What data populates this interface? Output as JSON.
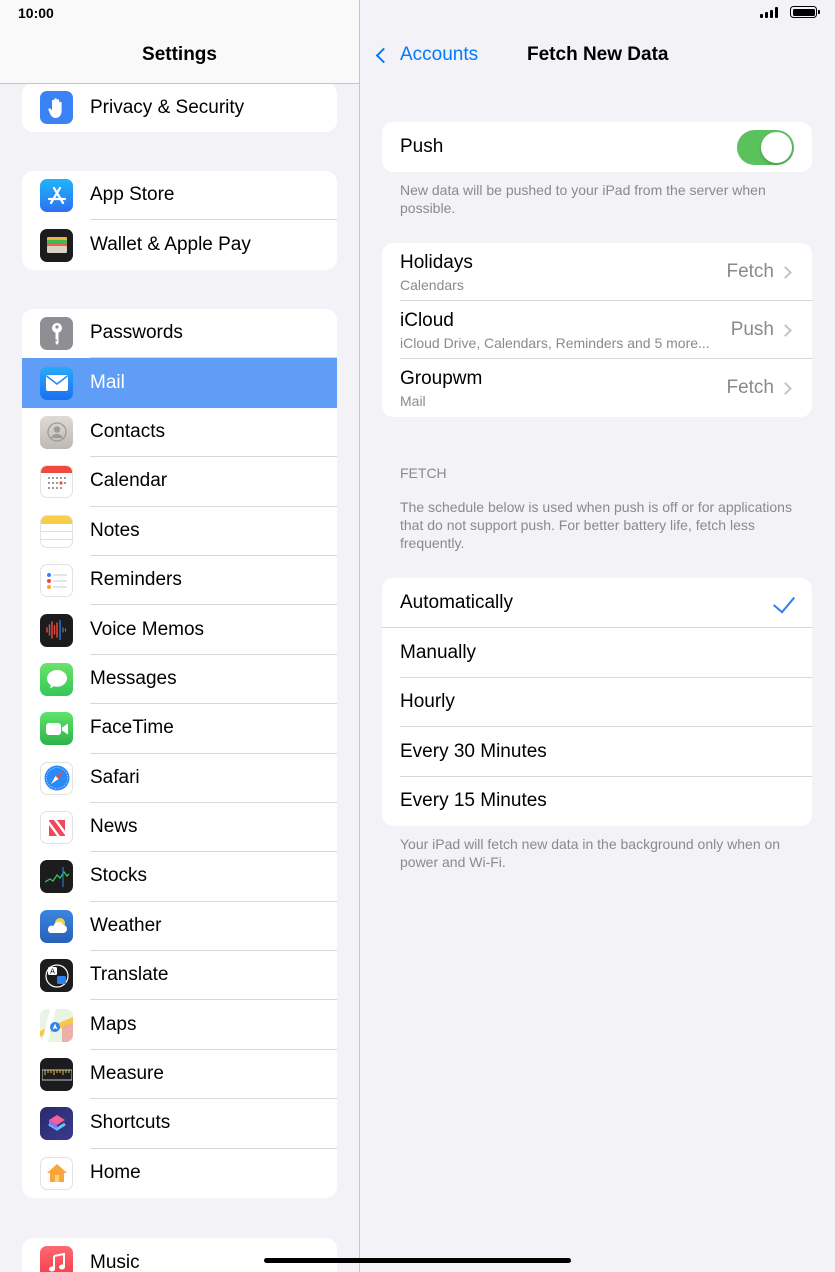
{
  "status": {
    "time": "10:00"
  },
  "left": {
    "title": "Settings",
    "groups": [
      [
        {
          "label": "Privacy & Security",
          "icon": "hand-icon",
          "color": "#3b82f6"
        }
      ],
      [
        {
          "label": "App Store",
          "icon": "app-store-icon",
          "color": "#2d8cf0"
        },
        {
          "label": "Wallet & Apple Pay",
          "icon": "wallet-icon",
          "color": "#1c1c1e"
        }
      ],
      [
        {
          "label": "Passwords",
          "icon": "key-icon",
          "color": "#8e8e93"
        },
        {
          "label": "Mail",
          "icon": "mail-icon",
          "color": "#3b95f5"
        },
        {
          "label": "Contacts",
          "icon": "contacts-icon",
          "color": "#c8c5bf"
        },
        {
          "label": "Calendar",
          "icon": "calendar-icon",
          "color": "#ffffff"
        },
        {
          "label": "Notes",
          "icon": "notes-icon",
          "color": "#ffffff"
        },
        {
          "label": "Reminders",
          "icon": "reminders-icon",
          "color": "#ffffff"
        },
        {
          "label": "Voice Memos",
          "icon": "voice-memos-icon",
          "color": "#1c1c1e"
        },
        {
          "label": "Messages",
          "icon": "messages-icon",
          "color": "#4cd964"
        },
        {
          "label": "FaceTime",
          "icon": "facetime-icon",
          "color": "#34c759"
        },
        {
          "label": "Safari",
          "icon": "safari-icon",
          "color": "#ffffff"
        },
        {
          "label": "News",
          "icon": "news-icon",
          "color": "#ffffff"
        },
        {
          "label": "Stocks",
          "icon": "stocks-icon",
          "color": "#1c1c1e"
        },
        {
          "label": "Weather",
          "icon": "weather-icon",
          "color": "#3a7bd5"
        },
        {
          "label": "Translate",
          "icon": "translate-icon",
          "color": "#1c1c1e"
        },
        {
          "label": "Maps",
          "icon": "maps-icon",
          "color": "#e8f4e4"
        },
        {
          "label": "Measure",
          "icon": "measure-icon",
          "color": "#1c1c1e"
        },
        {
          "label": "Shortcuts",
          "icon": "shortcuts-icon",
          "color": "#3a3a8c"
        },
        {
          "label": "Home",
          "icon": "home-icon",
          "color": "#ffffff"
        }
      ],
      [
        {
          "label": "Music",
          "icon": "music-icon",
          "color": "#fc3c44"
        }
      ]
    ],
    "selected": "Mail"
  },
  "right": {
    "back_label": "Accounts",
    "title": "Fetch New Data",
    "push": {
      "label": "Push",
      "on": true,
      "footer": "New data will be pushed to your iPad from the server when possible."
    },
    "accounts": [
      {
        "name": "Holidays",
        "detail": "Calendars",
        "value": "Fetch"
      },
      {
        "name": "iCloud",
        "detail": "iCloud Drive, Calendars, Reminders and 5 more...",
        "value": "Push"
      },
      {
        "name": "Groupwm",
        "detail": "Mail",
        "value": "Fetch"
      }
    ],
    "fetch_header": "FETCH",
    "fetch_desc": "The schedule below is used when push is off or for applications that do not support push. For better battery life, fetch less frequently.",
    "options": [
      "Automatically",
      "Manually",
      "Hourly",
      "Every 30 Minutes",
      "Every 15 Minutes"
    ],
    "selected_option": "Automatically",
    "options_footer": "Your iPad will fetch new data in the background only when on power and Wi-Fi."
  }
}
